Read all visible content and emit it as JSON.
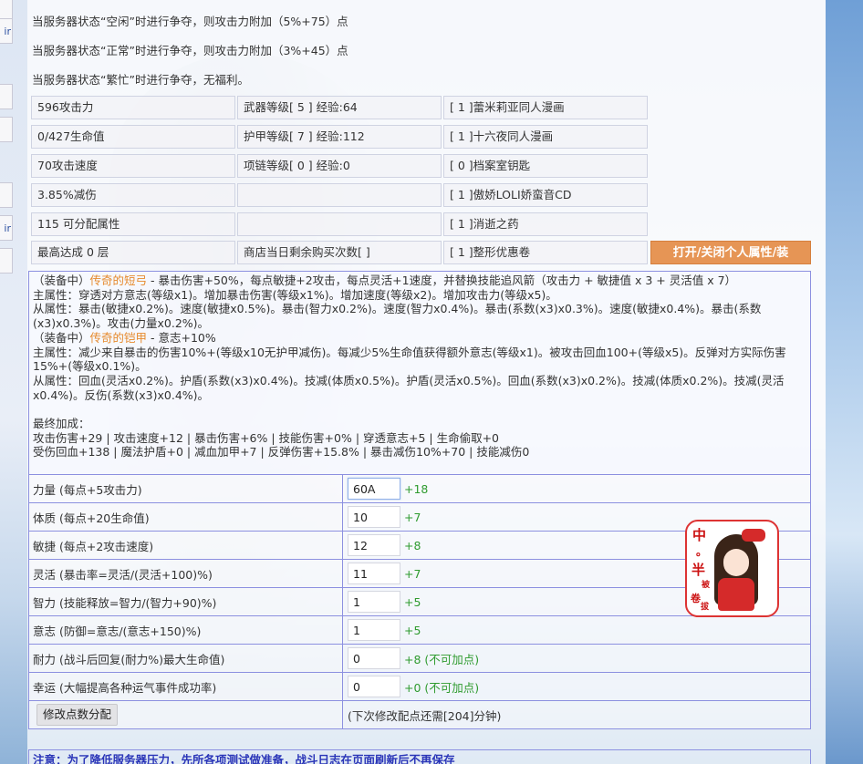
{
  "left_tabs": [
    "",
    "ir",
    "",
    "",
    "",
    "ir",
    ""
  ],
  "notices": [
    "当服务器状态“空闲”时进行争夺，则攻击力附加（5%+75）点",
    "当服务器状态“正常”时进行争夺，则攻击力附加（3%+45）点",
    "当服务器状态“繁忙”时进行争夺，无福利。"
  ],
  "stats": {
    "col1": [
      "596攻击力",
      "0/427生命值",
      "70攻击速度",
      "3.85%减伤",
      "115 可分配属性",
      "最高达成 0 层"
    ],
    "col2": [
      "武器等级[ 5 ] 经验:64",
      "护甲等级[ 7 ] 经验:112",
      "项链等级[ 0 ] 经验:0",
      "",
      "",
      "商店当日剩余购买次数[ ]"
    ],
    "col3": [
      "[ 1 ]蕾米莉亚同人漫画",
      "[ 1 ]十六夜同人漫画",
      "[ 0 ]档案室钥匙",
      "[ 1 ]傲娇LOLI娇蛮音CD",
      "[ 1 ]消逝之药",
      "[ 1 ]整形优惠卷"
    ]
  },
  "toggle_button": "打开/关闭个人属性/装",
  "equipment": {
    "weapon_prefix": "（装备中）",
    "weapon_name": "传奇的短弓",
    "weapon_desc": " - 暴击伤害+50%，每点敏捷+2攻击，每点灵活+1速度，并替换技能追风箭（攻击力 + 敏捷值 x 3 + 灵活值 x 7）",
    "weapon_main": "主属性：穿透对方意志(等级x1)。增加暴击伤害(等级x1%)。增加速度(等级x2)。增加攻击力(等级x5)。",
    "weapon_sub": "从属性：暴击(敏捷x0.2%)。速度(敏捷x0.5%)。暴击(智力x0.2%)。速度(智力x0.4%)。暴击(系数(x3)x0.3%)。速度(敏捷x0.4%)。暴击(系数(x3)x0.3%)。攻击(力量x0.2%)。",
    "armor_prefix": "（装备中）",
    "armor_name": "传奇的铠甲",
    "armor_desc": " - 意志+10%",
    "armor_main": "主属性：减少来自暴击的伤害10%+(等级x10无护甲减伤)。每减少5%生命值获得额外意志(等级x1)。被攻击回血100+(等级x5)。反弹对方实际伤害15%+(等级x0.1%)。",
    "armor_sub": "从属性：回血(灵活x0.2%)。护盾(系数(x3)x0.4%)。技减(体质x0.5%)。护盾(灵活x0.5%)。回血(系数(x3)x0.2%)。技减(体质x0.2%)。技减(灵活x0.4%)。反伤(系数(x3)x0.4%)。",
    "final_title": "最终加成：",
    "final_line1": "攻击伤害+29 | 攻击速度+12 | 暴击伤害+6% | 技能伤害+0% | 穿透意志+5 | 生命偷取+0",
    "final_line2": "受伤回血+138 | 魔法护盾+0 | 减血加甲+7 | 反弹伤害+15.8% | 暴击减伤10%+70 | 技能减伤0"
  },
  "attributes": [
    {
      "label": "力量 (每点+5攻击力)",
      "value": "60A",
      "bonus": "+18"
    },
    {
      "label": "体质 (每点+20生命值)",
      "value": "10",
      "bonus": "+7"
    },
    {
      "label": "敏捷 (每点+2攻击速度)",
      "value": "12",
      "bonus": "+8"
    },
    {
      "label": "灵活 (暴击率=灵活/(灵活+100)%)",
      "value": "11",
      "bonus": "+7"
    },
    {
      "label": "智力 (技能释放=智力/(智力+90)%)",
      "value": "1",
      "bonus": "+5"
    },
    {
      "label": "意志 (防御=意志/(意志+150)%)",
      "value": "1",
      "bonus": "+5"
    },
    {
      "label": "耐力 (战斗后回复(耐力%)最大生命值)",
      "value": "0",
      "bonus": "+8 (不可加点)"
    },
    {
      "label": "幸运 (大幅提高各种运气事件成功率)",
      "value": "0",
      "bonus": "+0 (不可加点)"
    }
  ],
  "modify_button": "修改点数分配",
  "modify_note": "(下次修改配点还需[204]分钟)",
  "bottom_note": "注意：为了降低服务器压力，先所各项测试做准备，战斗日志在页面刷新后不再保存",
  "stamp_text": [
    "中",
    "。",
    "半",
    "被",
    "卷",
    "拔"
  ],
  "colors": {
    "accent_orange": "#e69555",
    "item_name": "#e68a2e",
    "bonus_green": "#2f9b2f",
    "border_blue": "#8c90e0"
  }
}
